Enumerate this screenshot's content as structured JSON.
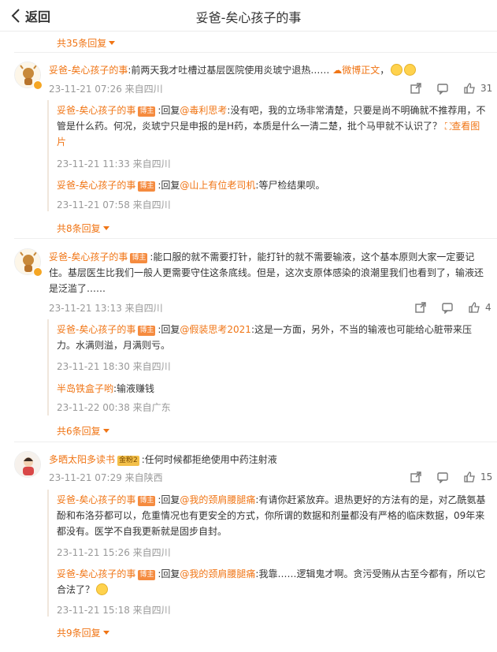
{
  "header": {
    "back_label": "返回",
    "title": "妥爸-矣心孩子的事"
  },
  "top_more": "共35条回复",
  "threads": [
    {
      "username": "妥爸-矣心孩子的事",
      "text": ":前两天我才吐槽过基层医院使用炎琥宁退热……",
      "link": "微博正文",
      "meta": "23-11-21 07:26 来自四川",
      "likes": "31",
      "replies": [
        {
          "username": "妥爸-矣心孩子的事",
          "tag": "博主",
          "prefix": ":回复",
          "mention": "@毒利思考",
          "text_line1": ":没有吧，我的立场非常清楚，只要是尚不明确就不推",
          "text_line2": "荐用，不管是什么药。何况，炎琥宁只是申报的是H药，本质是什么一清二楚，批个马甲就不",
          "text_line3": "认识了？",
          "pic_label": "查看图片",
          "meta": "23-11-21 11:33 来自四川"
        },
        {
          "username": "妥爸-矣心孩子的事",
          "tag": "博主",
          "prefix": ":回复",
          "mention": "@山上有位老司机",
          "text": ":等尸检结果呗。",
          "meta": "23-11-21 07:58 来自四川"
        }
      ],
      "more": "共8条回复"
    },
    {
      "username": "妥爸-矣心孩子的事",
      "tag": "博主",
      "text_line1": ":能口服的就不需要打针，能打针的就不需要输液，这个基本原则大家一",
      "text_line2": "定要记住。基层医生比我们一般人更需要守住这条底线。但是，这次支原体感染的浪潮里我们也",
      "text_line3": "看到了，输液还是泛滥了……",
      "meta": "23-11-21 13:13 来自四川",
      "likes": "4",
      "replies": [
        {
          "username": "妥爸-矣心孩子的事",
          "tag": "博主",
          "prefix": ":回复",
          "mention": "@假装思考2021",
          "text_line1": ":这是一方面，另外，不当的输液也可能给心脏带",
          "text_line2": "来压力。水满则溢，月满则亏。",
          "meta": "23-11-21 18:30 来自四川"
        },
        {
          "username": "半岛铁盒子哟",
          "text": ":输液赚钱",
          "meta": "23-11-22 00:38 来自广东"
        }
      ],
      "more": "共6条回复"
    },
    {
      "username": "多晒太阳多读书",
      "tag": "金粉2",
      "text": ":任何时候都拒绝使用中药注射液",
      "meta": "23-11-21 07:29 来自陕西",
      "likes": "15",
      "replies": [
        {
          "username": "妥爸-矣心孩子的事",
          "tag": "博主",
          "prefix": ":回复",
          "mention": "@我的颈肩腰腿痛",
          "text_line1": ":有请你赶紧放弃。退热更好的方法有的是，对",
          "text_line2": "乙酰氨基酚和布洛芬都可以，危重情况也有更安全的方式，你所谓的数据和剂量都没有严格的",
          "text_line3": "临床数据，09年来都没有。医学不自我更新就是固步自封。",
          "meta": "23-11-21 15:26 来自四川"
        },
        {
          "username": "妥爸-矣心孩子的事",
          "tag": "博主",
          "prefix": ":回复",
          "mention": "@我的颈肩腰腿痛",
          "text_line1": ":我靠……逻辑鬼才啊。贪污受贿从古至今都",
          "text_line2": "有，所以它合法了？",
          "meta": "23-11-21 15:18 来自四川"
        }
      ],
      "more": "共9条回复"
    }
  ]
}
